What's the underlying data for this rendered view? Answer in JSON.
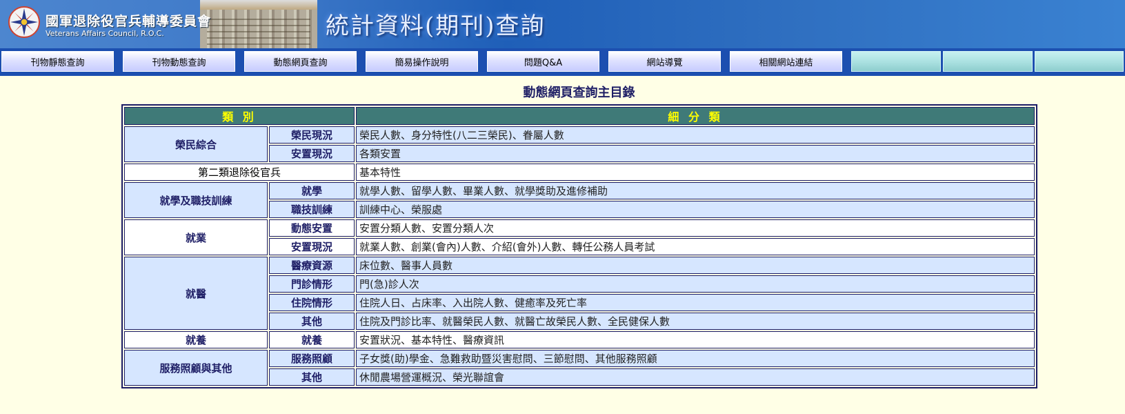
{
  "header": {
    "org_cn": "國軍退除役官兵輔導委員會",
    "org_en": "Veterans Affairs Council, R.O.C.",
    "site_title": "統計資料(期刊)查詢",
    "colors": {
      "banner": "#2f6fc0",
      "nav": "#1c4fb0",
      "page_bg": "#ffffe6"
    }
  },
  "nav": {
    "items": [
      "刊物靜態查詢",
      "刊物動態查詢",
      "動態網頁查詢",
      "簡易操作說明",
      "問題Q&A",
      "網站導覽",
      "相關網站連結"
    ]
  },
  "main": {
    "title": "動態網頁查詢主目錄",
    "table": {
      "headers": [
        "類 別",
        "細 分 類"
      ],
      "header_colors": {
        "bg": "#3f7a78",
        "fg": "#ffff00"
      },
      "groups": [
        {
          "category": "榮民綜合",
          "rows": [
            {
              "sub": "榮民現況",
              "detail": "榮民人數、身分特性(八二三榮民)、眷屬人數"
            },
            {
              "sub": "安置現況",
              "detail": "各類安置"
            }
          ]
        },
        {
          "category": "第二類退除役官兵",
          "rows": [
            {
              "sub": "",
              "detail": "基本特性"
            }
          ]
        },
        {
          "category": "就學及職技訓練",
          "rows": [
            {
              "sub": "就學",
              "detail": "就學人數、留學人數、畢業人數、就學獎助及進修補助"
            },
            {
              "sub": "職技訓練",
              "detail": "訓練中心、榮服處"
            }
          ]
        },
        {
          "category": "就業",
          "rows": [
            {
              "sub": "動態安置",
              "detail": "安置分類人數、安置分類人次"
            },
            {
              "sub": "安置現況",
              "detail": "就業人數、創業(會內)人數、介紹(會外)人數、轉任公務人員考試"
            }
          ]
        },
        {
          "category": "就醫",
          "rows": [
            {
              "sub": "醫療資源",
              "detail": "床位數、醫事人員數"
            },
            {
              "sub": "門診情形",
              "detail": "門(急)診人次"
            },
            {
              "sub": "住院情形",
              "detail": "住院人日、占床率、入出院人數、健癒率及死亡率"
            },
            {
              "sub": "其他",
              "detail": "住院及門診比率、就醫榮民人數、就醫亡故榮民人數、全民健保人數"
            }
          ]
        },
        {
          "category": "就養",
          "rows": [
            {
              "sub": "就養",
              "detail": "安置狀況、基本特性、醫療資訊"
            }
          ]
        },
        {
          "category": "服務照顧與其他",
          "rows": [
            {
              "sub": "服務照顧",
              "detail": "子女獎(助)學金、急難救助暨災害慰問、三節慰問、其他服務照顧"
            },
            {
              "sub": "其他",
              "detail": "休閒農場營運概況、榮光聯誼會"
            }
          ]
        }
      ]
    }
  }
}
